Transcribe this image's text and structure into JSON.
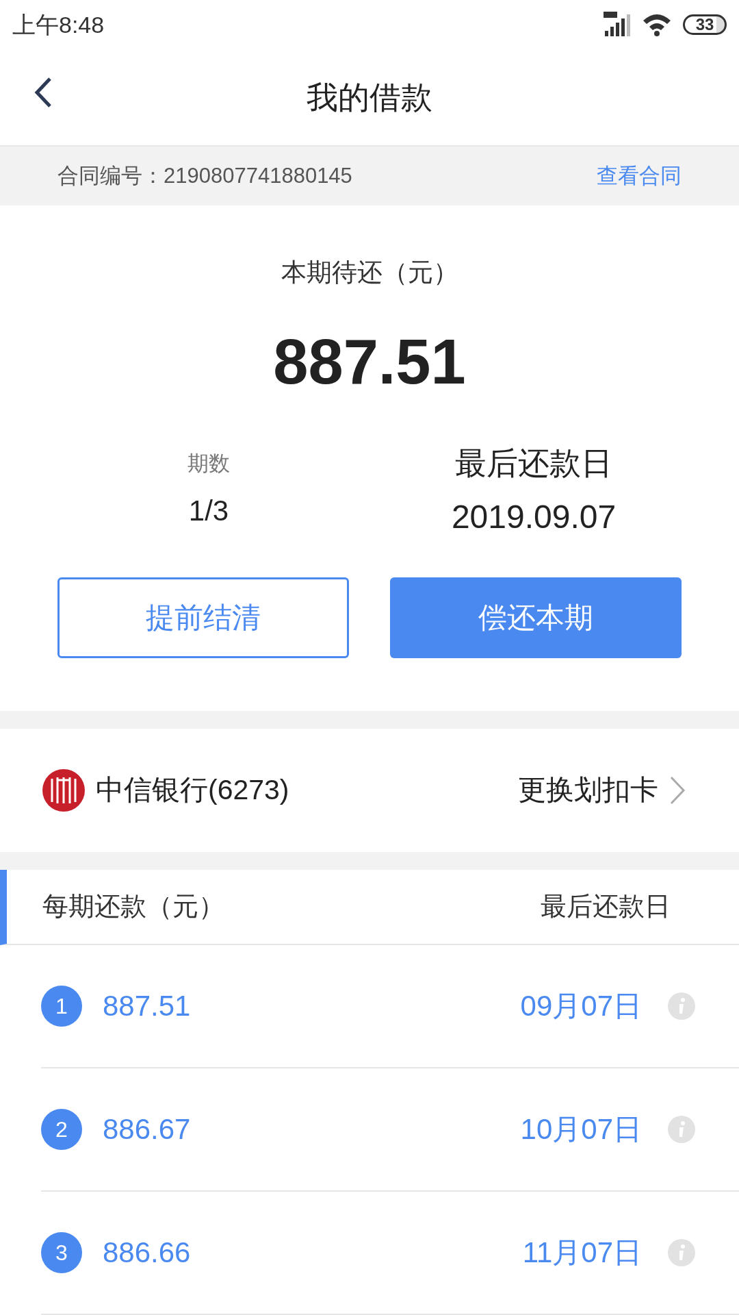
{
  "status_bar": {
    "time": "上午8:48",
    "battery": "33"
  },
  "header": {
    "title": "我的借款"
  },
  "contract": {
    "label": "合同编号：2190807741880145",
    "link": "查看合同"
  },
  "summary": {
    "label": "本期待还（元）",
    "amount": "887.51",
    "period_label": "期数",
    "period": "1/3",
    "due_label": "最后还款日",
    "due_date": "2019.09.07"
  },
  "buttons": [
    {
      "label": "提前结清",
      "kind": "outline"
    },
    {
      "label": "偿还本期",
      "kind": "primary"
    }
  ],
  "bank": {
    "name": "中信银行(6273)",
    "action": "更换划扣卡"
  },
  "schedule": {
    "columns": [
      "每期还款（元）",
      "最后还款日"
    ],
    "rows": [
      {
        "index": "1",
        "amount": "887.51",
        "date": "09月07日"
      },
      {
        "index": "2",
        "amount": "886.67",
        "date": "10月07日"
      },
      {
        "index": "3",
        "amount": "886.66",
        "date": "11月07日"
      }
    ]
  }
}
